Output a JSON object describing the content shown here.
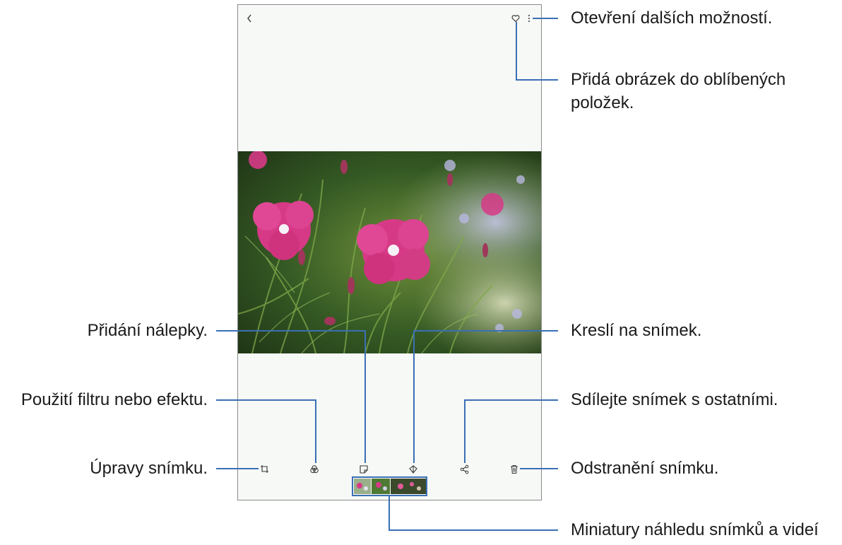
{
  "app": {
    "screen": "gallery-image-viewer"
  },
  "top_bar": {
    "back_icon": "back-arrow-icon",
    "favorite_icon": "heart-outline-icon",
    "more_icon": "more-options-icon"
  },
  "photo": {
    "subject_icon": "photo-pink-dianthus-flowers"
  },
  "bottom_toolbar": {
    "items": [
      {
        "icon": "crop-edit-icon"
      },
      {
        "icon": "filter-effects-icon"
      },
      {
        "icon": "sticker-icon"
      },
      {
        "icon": "draw-pen-icon"
      },
      {
        "icon": "share-icon"
      },
      {
        "icon": "trash-icon"
      }
    ]
  },
  "thumbnails": {
    "count": 3
  },
  "callouts": {
    "more_options": "Otevření dalších možností.",
    "favorite_line1": "Přidá obrázek do oblíbených",
    "favorite_line2": "položek.",
    "sticker": "Přidání nálepky.",
    "draw": "Kreslí na snímek.",
    "filter": "Použití filtru nebo efektu.",
    "share": "Sdílejte snímek s ostatními.",
    "edit": "Úpravy snímku.",
    "delete": "Odstranění snímku.",
    "thumbnails": "Miniatury náhledu snímků a videí"
  },
  "colors": {
    "callout_line": "#3a6fb5",
    "flower_pink": "#d63a86",
    "background_panel": "#f7f9f7"
  }
}
